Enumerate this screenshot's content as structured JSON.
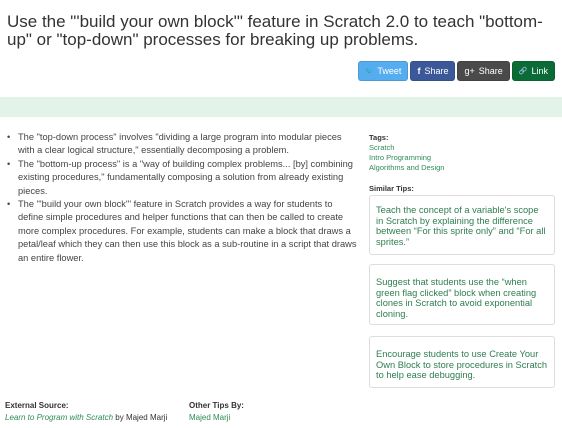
{
  "title": "Use the \"'build your own block'\" feature in Scratch 2.0 to teach \"bottom-up\" or \"top-down\" processes for breaking up problems.",
  "share": [
    {
      "label": "Tweet",
      "icon": "twitter-icon",
      "glyph": "🐦",
      "color": "#55acee"
    },
    {
      "label": "Share",
      "icon": "facebook-icon",
      "glyph": "f",
      "color": "#3b5998"
    },
    {
      "label": "Share",
      "icon": "google-plus-icon",
      "glyph": "g+",
      "color": "#4a4a4a"
    },
    {
      "label": "Link",
      "icon": "link-icon",
      "glyph": "🔗",
      "color": "#0b6b37"
    }
  ],
  "bullets": [
    "The \"top-down process\" involves \"dividing a large program into modular pieces with a clear logical structure,\" essentially decomposing a problem.",
    "The \"bottom-up process\" is a \"way of building complex problems... [by] combining existing procedures,\" fundamentally composing a solution from already existing pieces.",
    "The \"'build your own block'\" feature in Scratch provides a way for students to define simple procedures and helper functions that can then be called to create more complex procedures. For example, students can make a block that draws a petal/leaf which they can then use this block as a sub-routine in a script that draws an entire flower."
  ],
  "tags_label": "Tags:",
  "tags": [
    "Scratch",
    "Intro Programming",
    "Algorithms and Design"
  ],
  "similar_label": "Similar Tips:",
  "similar": [
    "Teach the concept of a variable's scope in Scratch by explaining the difference between “For this sprite only” and “For all sprites.”",
    "Suggest that students use the “when green flag clicked” block when creating clones in Scratch to avoid exponential cloning.",
    "Encourage students to use Create Your Own Block to store procedures in Scratch to help ease debugging."
  ],
  "footer": {
    "source_label": "External Source:",
    "source_title": "Learn to Program with Scratch",
    "source_by": " by Majed Marji",
    "other_label": "Other Tips By:",
    "other_author": "Majed Marji"
  }
}
